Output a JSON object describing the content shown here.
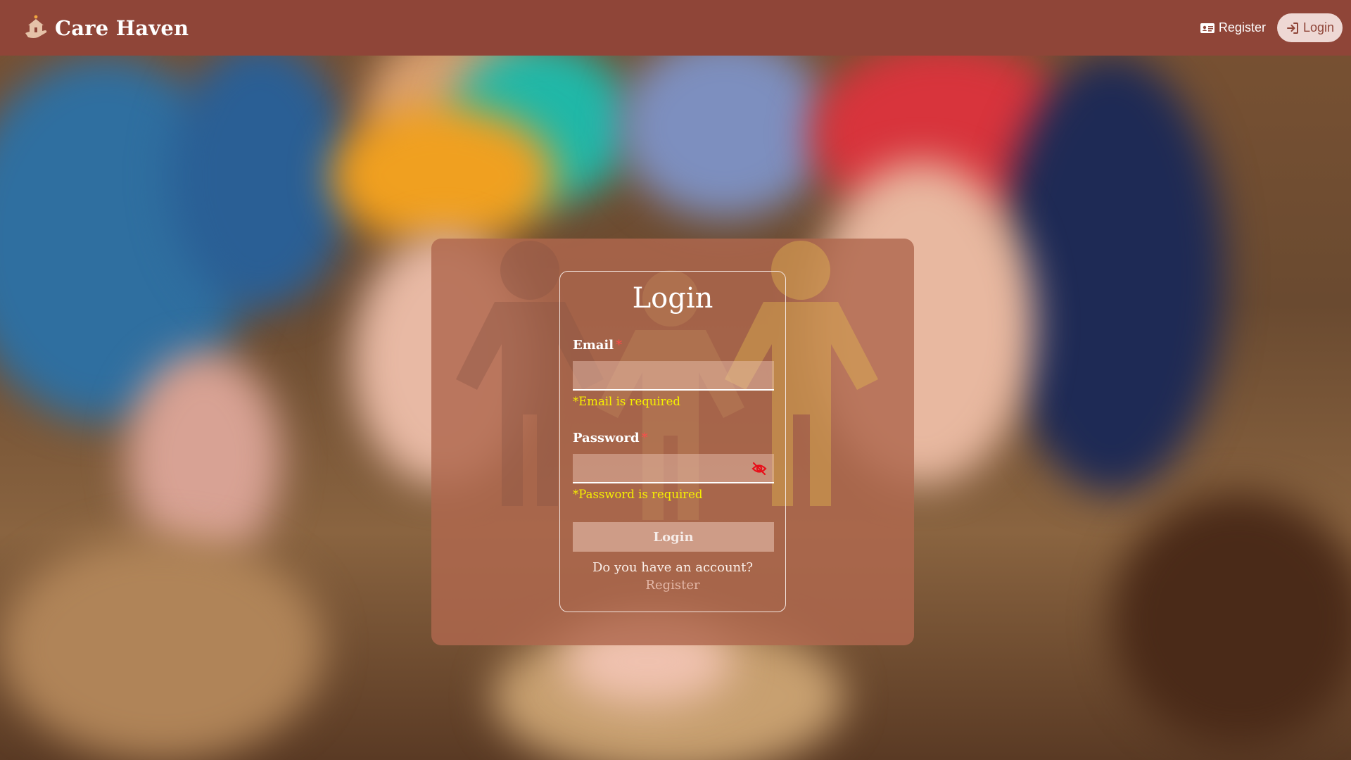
{
  "header": {
    "brand_name": "Care Haven",
    "nav": {
      "register_label": "Register",
      "login_label": "Login"
    }
  },
  "login_form": {
    "title": "Login",
    "email": {
      "label": "Email",
      "required_mark": "*",
      "value": "",
      "error": "*Email is required"
    },
    "password": {
      "label": "Password",
      "required_mark": "*",
      "value": "",
      "error": "*Password is required",
      "toggle_icon": "eye-slash-icon"
    },
    "submit_label": "Login",
    "account_question": "Do you have an account?",
    "register_link": "Register"
  },
  "colors": {
    "header_bg": "#8f4538",
    "overlay_bg": "#b0684e",
    "error": "#f6f000",
    "required": "#ff4a4a"
  }
}
